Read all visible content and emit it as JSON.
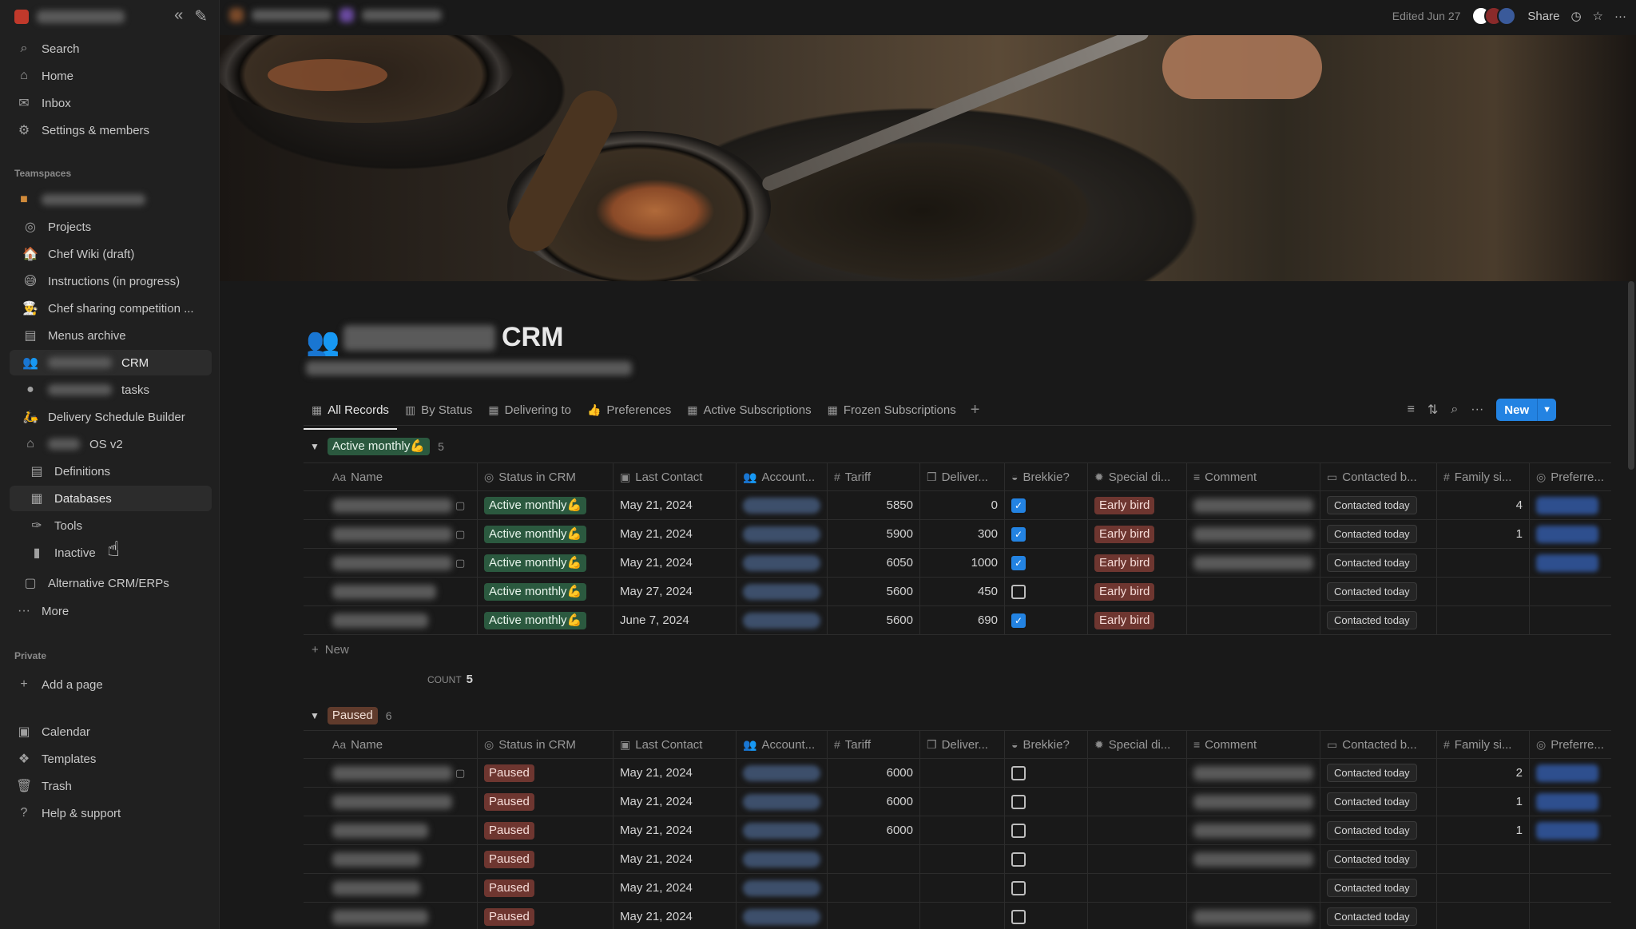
{
  "sidebar": {
    "top": [
      "Search",
      "Home",
      "Inbox",
      "Settings & members"
    ],
    "teamspaces_label": "Teamspaces",
    "teamspace_items": [
      "Projects",
      "Chef Wiki (draft)",
      "Instructions (in progress)",
      "Chef sharing competition ...",
      "Menus archive",
      "CRM",
      "tasks",
      "Delivery Schedule Builder",
      "OS v2",
      "Definitions",
      "Databases",
      "Tools",
      "Inactive",
      "Alternative CRM/ERPs",
      "More"
    ],
    "private_label": "Private",
    "add_page": "Add a page",
    "bottom": [
      "Calendar",
      "Templates",
      "Trash",
      "Help & support"
    ]
  },
  "topbar": {
    "edited": "Edited Jun 27",
    "share": "Share"
  },
  "page": {
    "title": "CRM"
  },
  "tabs": [
    "All Records",
    "By Status",
    "Delivering to",
    "Preferences",
    "Active Subscriptions",
    "Frozen Subscriptions"
  ],
  "new_button": "New",
  "columns": [
    "Name",
    "Status in CRM",
    "Last Contact",
    "Account...",
    "Tariff",
    "Deliver...",
    "Brekkie?",
    "Special di...",
    "Comment",
    "Contacted b...",
    "Family si...",
    "Preferre..."
  ],
  "group_active": {
    "label": "Active monthly💪",
    "count": "5",
    "rows": [
      {
        "status": "Active monthly💪",
        "date": "May 21, 2024",
        "tariff": "5850",
        "deliv": "0",
        "brek": true,
        "special": "Early bird",
        "contacted": "Contacted today",
        "family": "4"
      },
      {
        "status": "Active monthly💪",
        "date": "May 21, 2024",
        "tariff": "5900",
        "deliv": "300",
        "brek": true,
        "special": "Early bird",
        "contacted": "Contacted today",
        "family": "1"
      },
      {
        "status": "Active monthly💪",
        "date": "May 21, 2024",
        "tariff": "6050",
        "deliv": "1000",
        "brek": true,
        "special": "Early bird",
        "contacted": "Contacted today",
        "family": ""
      },
      {
        "status": "Active monthly💪",
        "date": "May 27, 2024",
        "tariff": "5600",
        "deliv": "450",
        "brek": false,
        "special": "Early bird",
        "contacted": "Contacted today",
        "family": ""
      },
      {
        "status": "Active monthly💪",
        "date": "June 7, 2024",
        "tariff": "5600",
        "deliv": "690",
        "brek": true,
        "special": "Early bird",
        "contacted": "Contacted today",
        "family": ""
      }
    ],
    "new_label": "New",
    "count_label": "COUNT",
    "count_value": "5"
  },
  "group_paused": {
    "label": "Paused",
    "count": "6",
    "rows": [
      {
        "status": "Paused",
        "date": "May 21, 2024",
        "tariff": "6000",
        "deliv": "",
        "brek": false,
        "contacted": "Contacted today",
        "family": "2"
      },
      {
        "status": "Paused",
        "date": "May 21, 2024",
        "tariff": "6000",
        "deliv": "",
        "brek": false,
        "contacted": "Contacted today",
        "family": "1"
      },
      {
        "status": "Paused",
        "date": "May 21, 2024",
        "tariff": "6000",
        "deliv": "",
        "brek": false,
        "contacted": "Contacted today",
        "family": "1"
      },
      {
        "status": "Paused",
        "date": "May 21, 2024",
        "tariff": "",
        "deliv": "",
        "brek": false,
        "contacted": "Contacted today",
        "family": ""
      },
      {
        "status": "Paused",
        "date": "May 21, 2024",
        "tariff": "",
        "deliv": "",
        "brek": false,
        "contacted": "Contacted today",
        "family": ""
      },
      {
        "status": "Paused",
        "date": "May 21, 2024",
        "tariff": "",
        "deliv": "",
        "brek": false,
        "contacted": "Contacted today",
        "family": ""
      }
    ]
  },
  "colors": {
    "accent": "#2383e2",
    "tag_green": "#2b593f",
    "tag_brown": "#603b2c",
    "tag_red": "#6e3630"
  }
}
